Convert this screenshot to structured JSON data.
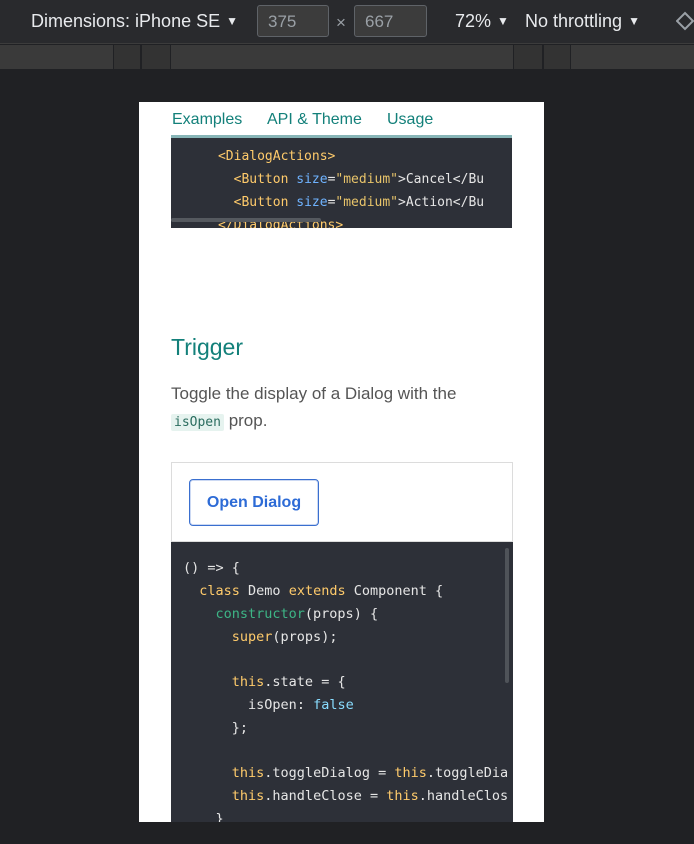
{
  "devtools": {
    "dimensions_label": "Dimensions: iPhone SE",
    "width_value": "375",
    "height_value": "667",
    "times": "×",
    "zoom": "72%",
    "throttling": "No throttling",
    "caret": "▼"
  },
  "page": {
    "tabs": [
      "Examples",
      "API & Theme",
      "Usage"
    ],
    "code_top": [
      {
        "indent": "      ",
        "open": "<DialogActions>"
      },
      {
        "indent": "        ",
        "tag": "<Button",
        "attr": "size",
        "value": "\"medium\"",
        "text": ">Cancel</Bu"
      },
      {
        "indent": "        ",
        "tag": "<Button",
        "attr": "size",
        "value": "\"medium\"",
        "text": ">Action</Bu"
      },
      {
        "indent": "      ",
        "close": "</DialogActions>"
      }
    ],
    "section_title": "Trigger",
    "description_before": "Toggle the display of a Dialog with the",
    "description_code": "isOpen",
    "description_after": " prop.",
    "button_label": "Open Dialog",
    "code_lines": [
      "() => {",
      "  class Demo extends Component {",
      "    constructor(props) {",
      "      super(props);",
      "",
      "      this.state = {",
      "        isOpen: false",
      "      };",
      "",
      "      this.toggleDialog = this.toggleDia",
      "      this.handleClose = this.handleClos",
      "    }"
    ]
  }
}
